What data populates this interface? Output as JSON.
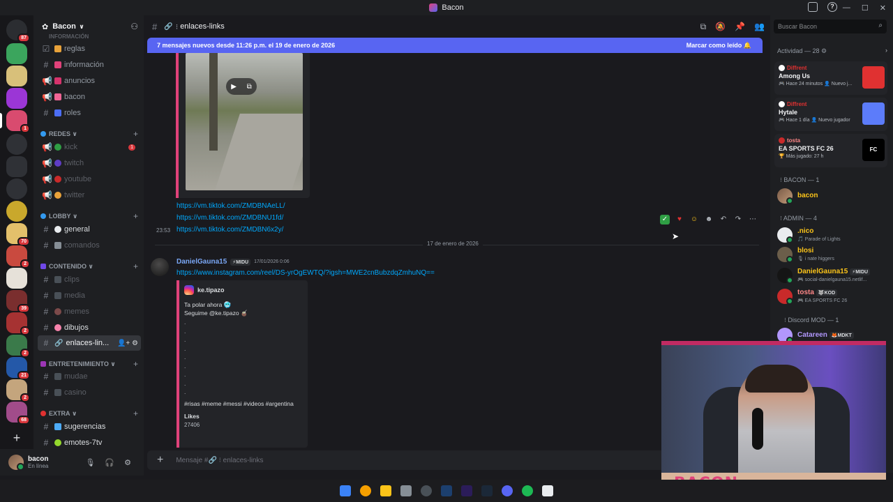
{
  "window": {
    "title": "Bacon"
  },
  "colors": {
    "accent": "#5865f2",
    "link": "#00a8fc",
    "embed_border": "#e0427a",
    "online": "#23a559",
    "badge": "#da373c"
  },
  "server_rail": {
    "badges": [
      "87",
      "1",
      "70",
      "2",
      "39",
      "2",
      "2",
      "21",
      "2",
      "68"
    ]
  },
  "server": {
    "name": "Bacon"
  },
  "channels": {
    "top_cut": "INFORMACIÓN",
    "items": [
      {
        "name": "reglas"
      },
      {
        "name": "información"
      },
      {
        "name": "anuncios"
      },
      {
        "name": "bacon"
      },
      {
        "name": "roles"
      }
    ],
    "categories": [
      {
        "name": "REDES"
      },
      {
        "name": "LOBBY"
      },
      {
        "name": "CONTENIDO"
      },
      {
        "name": "ENTRETENIMIENTO"
      },
      {
        "name": "EXTRA"
      }
    ],
    "redes": [
      {
        "name": "kick",
        "badge": "1"
      },
      {
        "name": "twitch"
      },
      {
        "name": "youtube"
      },
      {
        "name": "twitter"
      }
    ],
    "lobby": [
      {
        "name": "general"
      },
      {
        "name": "comandos"
      }
    ],
    "contenido": [
      {
        "name": "clips"
      },
      {
        "name": "media"
      },
      {
        "name": "memes"
      },
      {
        "name": "dibujos"
      },
      {
        "name": "enlaces-lin..."
      }
    ],
    "entretenimiento": [
      {
        "name": "mudae"
      },
      {
        "name": "casino"
      }
    ],
    "extra": [
      {
        "name": "sugerencias"
      },
      {
        "name": "emotes-7tv"
      }
    ]
  },
  "user": {
    "name": "bacon",
    "status": "En línea"
  },
  "main": {
    "channel": "enlaces-links",
    "banner": {
      "text": "7 mensajes nuevos desde 11:26 p.m. el 19 de enero de 2026",
      "action": "Marcar como leído"
    },
    "links": [
      "https://vm.tiktok.com/ZMDBNAeLL/",
      "https://vm.tiktok.com/ZMDBNU1fd/",
      "https://vm.tiktok.com/ZMDBN6x2y/"
    ],
    "link_time": "23:53",
    "date_divider": "17 de enero de 2026",
    "message2": {
      "author": "DanielGauna15",
      "tag": "MIDU",
      "time": "17/01/2026 0:06",
      "url": "https://www.instagram.com/reel/DS-yrOgEWTQ/?igsh=MWE2cnBubzdqZmhuNQ==",
      "embed": {
        "author": "ke.tipazo",
        "line1": "Ta polar ahora 🥶",
        "line2": "Seguime @ke.tipazo 🧉",
        "dots": [
          ".",
          ".",
          ".",
          ".",
          ".",
          ".",
          ".",
          ".",
          "."
        ],
        "tags": "#risas #meme #messi #videos #argentina",
        "likes_label": "Likes",
        "likes_value": "27406"
      }
    },
    "composer_placeholder": "Mensaje #🔗 ⁝ enlaces-links"
  },
  "members": {
    "search_placeholder": "Buscar Bacon",
    "activity_label": "Actividad — 28 ⚙",
    "activities": [
      {
        "user": "Diffrent",
        "game": "Among Us",
        "meta": "🎮 Hace 24 minutos  👤 Nuevo j..."
      },
      {
        "user": "Diffrent",
        "game": "Hytale",
        "meta": "🎮 Hace 1 día  👤 Nuevo jugador"
      },
      {
        "user": "tosta",
        "game": "EA SPORTS FC 26",
        "meta": "🏆 Más jugado: 27 h"
      }
    ],
    "groups": [
      {
        "title": "⁝ BACON — 1",
        "members": [
          {
            "name": "bacon",
            "sub": ""
          }
        ]
      },
      {
        "title": "⁝ ADMIN — 4",
        "members": [
          {
            "name": ".nico",
            "sub": "🎵 Parade of Lights"
          },
          {
            "name": "blosi",
            "sub": "🎙 i nate higgers"
          },
          {
            "name": "DanielGauna15",
            "tag": "MIDU",
            "sub": "🎮 social-danielgauna15.netlif..."
          },
          {
            "name": "tosta",
            "tag": "KOD",
            "sub": "🎮 EA SPORTS FC 26"
          }
        ]
      },
      {
        "title": "⁝ Discord MOD — 1",
        "members": [
          {
            "name": "Catareen",
            "tag": "MDKT",
            "sub": ""
          }
        ]
      }
    ]
  },
  "webcam": {
    "logo": "BACON"
  }
}
